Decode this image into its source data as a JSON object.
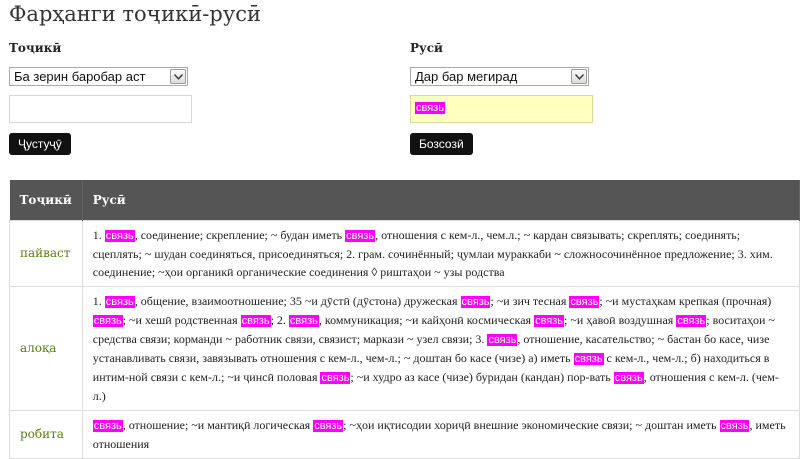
{
  "page": {
    "title": "Фарҳанги тоҷикӣ-русӣ"
  },
  "form": {
    "left": {
      "label": "Тоҷикӣ",
      "mode_selected": "Ба зерин баробар аст",
      "search_value": "",
      "button": "Ҷустуҷӯ"
    },
    "right": {
      "label": "Русӣ",
      "mode_selected": "Дар бар мегирад",
      "search_value": "связь",
      "button": "Бозсозӣ"
    }
  },
  "table": {
    "headers": [
      "Тоҷикӣ",
      "Русӣ"
    ],
    "highlight_term": "связь",
    "highlight_color": "#ff00ff",
    "rows": [
      {
        "word": "пайваст",
        "parts": [
          "1. ",
          {
            "hl": "связь"
          },
          ", соединение; скрепление; ~ будан иметь ",
          {
            "hl": "связь"
          },
          ", отношения с кем-л., чем.л.; ~ кардан связывать; скреплять; соединять; сцеплять; ~ шудан соединяться, присоединяться; 2. грам. сочинённый; ҷумлаи мураккаби ~ сложносочинённое предложение; 3. хим. соединение; ~ҳои органикӣ органические соединения ◊ риштаҳои ~ узы родства"
        ]
      },
      {
        "word": "алоқа",
        "parts": [
          "1. ",
          {
            "hl": "связь"
          },
          ", общение, взаимоотношение; 35 ~и дӯстӣ (дӯстона) дружеская ",
          {
            "hl": "связь"
          },
          "; ~и зич тесная ",
          {
            "hl": "связь"
          },
          "; ~и мустаҳкам крепкая (прочная) ",
          {
            "hl": "связь"
          },
          "; ~и хешӣ родственная ",
          {
            "hl": "связь"
          },
          "; 2. ",
          {
            "hl": "связь"
          },
          ", коммуникация; ~и кайҳонӣ космическая ",
          {
            "hl": "связь"
          },
          "; ~и ҳавоӣ воздушная ",
          {
            "hl": "связь"
          },
          "; воситаҳои ~ средства связи; корманди ~ работник связи, связист; маркази ~ узел связи; 3. ",
          {
            "hl": "связь"
          },
          ", отношение, касательство; ~ бастан бо касе, чизе устанавливать связи, завязывать отношения с кем-л., чем-л.; ~ доштан бо касе (чизе) а) иметь ",
          {
            "hl": "связь"
          },
          " с кем-л., чем-л.; б) находиться в интим-ной связи с кем-л.; ~и ҷинсӣ половая ",
          {
            "hl": "связь"
          },
          "; ~и худро аз касе (чизе) буридан (кандан) пор-вать ",
          {
            "hl": "связь"
          },
          ", отношения с кем-л. (чем-л.)"
        ]
      },
      {
        "word": "робита",
        "parts": [
          {
            "hl": "связь"
          },
          ", отношение; ~и мантиқӣ логическая ",
          {
            "hl": "связь"
          },
          "; ~ҳои иқтисодии хориҷӣ внешние экономические связи; ~ доштан иметь ",
          {
            "hl": "связь"
          },
          ", иметь отношения"
        ]
      }
    ]
  }
}
